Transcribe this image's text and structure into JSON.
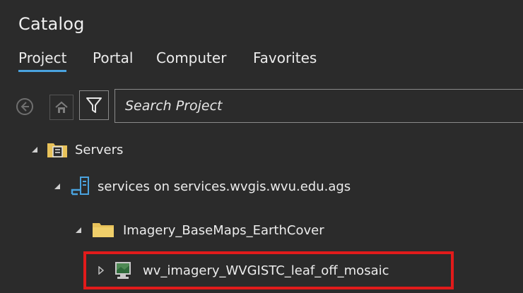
{
  "pane": {
    "title": "Catalog"
  },
  "tabs": [
    {
      "label": "Project",
      "active": true
    },
    {
      "label": "Portal",
      "active": false
    },
    {
      "label": "Computer",
      "active": false
    },
    {
      "label": "Favorites",
      "active": false
    }
  ],
  "toolbar": {
    "back_icon": "back-arrow-icon",
    "home_icon": "home-icon",
    "filter_icon": "filter-icon",
    "search_placeholder": "Search Project"
  },
  "tree": {
    "servers": {
      "label": "Servers",
      "expanded": true,
      "icon": "servers-folder-icon"
    },
    "connection": {
      "label": "services on services.wvgis.wvu.edu.ags",
      "expanded": true,
      "icon": "server-connection-icon"
    },
    "folder": {
      "label": "Imagery_BaseMaps_EarthCover",
      "expanded": true,
      "icon": "folder-icon"
    },
    "service": {
      "label": "wv_imagery_WVGISTC_leaf_off_mosaic",
      "expanded": false,
      "icon": "image-service-icon",
      "highlighted": true
    }
  },
  "colors": {
    "background": "#2b2b2b",
    "accent": "#4aa3df",
    "highlight_border": "#e11b1b",
    "folder": "#e8c25a"
  }
}
